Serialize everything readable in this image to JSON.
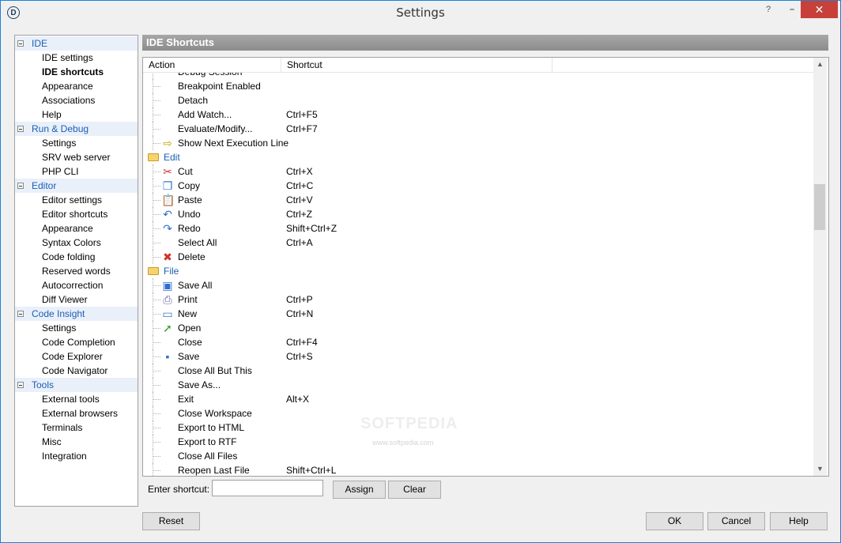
{
  "window": {
    "title": "Settings",
    "help_glyph": "?",
    "min_glyph": "–",
    "close_glyph": "✕",
    "app_glyph": "D"
  },
  "tree": {
    "groups": [
      {
        "label": "IDE",
        "items": [
          "IDE settings",
          "IDE shortcuts",
          "Appearance",
          "Associations",
          "Help"
        ]
      },
      {
        "label": "Run & Debug",
        "items": [
          "Settings",
          "SRV web server",
          "PHP CLI"
        ]
      },
      {
        "label": "Editor",
        "items": [
          "Editor settings",
          "Editor shortcuts",
          "Appearance",
          "Syntax Colors",
          "Code folding",
          "Reserved words",
          "Autocorrection",
          "Diff Viewer"
        ]
      },
      {
        "label": "Code Insight",
        "items": [
          "Settings",
          "Code Completion",
          "Code Explorer",
          "Code Navigator"
        ]
      },
      {
        "label": "Tools",
        "items": [
          "External tools",
          "External browsers",
          "Terminals",
          "Misc",
          "Integration"
        ]
      }
    ],
    "selected": "IDE shortcuts"
  },
  "panel": {
    "title": "IDE Shortcuts"
  },
  "list": {
    "columns": [
      "Action",
      "Shortcut"
    ],
    "rows": [
      {
        "action": "Debug Session",
        "shortcut": "",
        "icon": ""
      },
      {
        "action": "Breakpoint Enabled",
        "shortcut": "",
        "icon": ""
      },
      {
        "action": "Detach",
        "shortcut": "",
        "icon": ""
      },
      {
        "action": "Add Watch...",
        "shortcut": "Ctrl+F5",
        "icon": ""
      },
      {
        "action": "Evaluate/Modify...",
        "shortcut": "Ctrl+F7",
        "icon": ""
      },
      {
        "action": "Show Next Execution Line",
        "shortcut": "",
        "icon": "arrow-right-icon"
      },
      {
        "action": "Edit",
        "shortcut": "",
        "icon": "folder-icon",
        "category": true
      },
      {
        "action": "Cut",
        "shortcut": "Ctrl+X",
        "icon": "scissors-icon"
      },
      {
        "action": "Copy",
        "shortcut": "Ctrl+C",
        "icon": "copy-icon"
      },
      {
        "action": "Paste",
        "shortcut": "Ctrl+V",
        "icon": "paste-icon"
      },
      {
        "action": "Undo",
        "shortcut": "Ctrl+Z",
        "icon": "undo-icon"
      },
      {
        "action": "Redo",
        "shortcut": "Shift+Ctrl+Z",
        "icon": "redo-icon"
      },
      {
        "action": "Select All",
        "shortcut": "Ctrl+A",
        "icon": ""
      },
      {
        "action": "Delete",
        "shortcut": "",
        "icon": "delete-icon"
      },
      {
        "action": "File",
        "shortcut": "",
        "icon": "folder-icon",
        "category": true
      },
      {
        "action": "Save All",
        "shortcut": "",
        "icon": "save-all-icon"
      },
      {
        "action": "Print",
        "shortcut": "Ctrl+P",
        "icon": "printer-icon"
      },
      {
        "action": "New",
        "shortcut": "Ctrl+N",
        "icon": "new-file-icon"
      },
      {
        "action": "Open",
        "shortcut": "",
        "icon": "open-file-icon"
      },
      {
        "action": "Close",
        "shortcut": "Ctrl+F4",
        "icon": ""
      },
      {
        "action": "Save",
        "shortcut": "Ctrl+S",
        "icon": "save-icon"
      },
      {
        "action": "Close All But This",
        "shortcut": "",
        "icon": ""
      },
      {
        "action": "Save As...",
        "shortcut": "",
        "icon": ""
      },
      {
        "action": "Exit",
        "shortcut": "Alt+X",
        "icon": ""
      },
      {
        "action": "Close Workspace",
        "shortcut": "",
        "icon": ""
      },
      {
        "action": "Export to HTML",
        "shortcut": "",
        "icon": ""
      },
      {
        "action": "Export to RTF",
        "shortcut": "",
        "icon": ""
      },
      {
        "action": "Close All Files",
        "shortcut": "",
        "icon": ""
      },
      {
        "action": "Reopen Last File",
        "shortcut": "Shift+Ctrl+L",
        "icon": ""
      }
    ]
  },
  "shortcut_entry": {
    "label": "Enter shortcut:",
    "value": "",
    "assign_label": "Assign",
    "clear_label": "Clear"
  },
  "footer": {
    "reset_label": "Reset",
    "ok_label": "OK",
    "cancel_label": "Cancel",
    "help_label": "Help"
  },
  "watermark": {
    "text": "SOFTPEDIA",
    "url": "www.softpedia.com"
  },
  "colors": {
    "accent": "#1a5fb4",
    "header": "#9a9a9a",
    "close": "#c7403a"
  }
}
